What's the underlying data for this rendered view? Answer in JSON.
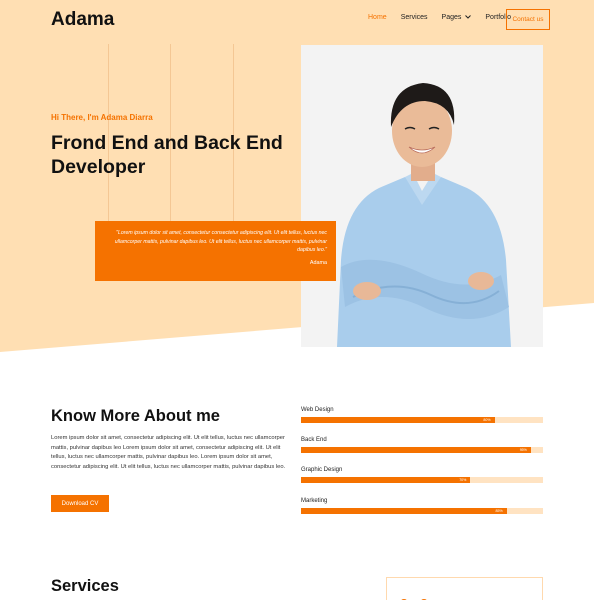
{
  "nav": {
    "logo": "Adama",
    "links": [
      {
        "label": "Home",
        "active": true
      },
      {
        "label": "Services",
        "active": false
      },
      {
        "label": "Pages",
        "active": false,
        "has_dropdown": true
      },
      {
        "label": "Portfolio",
        "active": false
      }
    ],
    "contact_label": "Contact us"
  },
  "hero": {
    "greeting": "Hi There, I'm Adama Diarra",
    "title_line1": "Frond End and Back End",
    "title_line2": "Developer",
    "quote": "\"Lorem ipsum dolor sit amet, consectetur consectetur adipiscing elit. Ut elit tellus, luctus nec ullamcorper mattis, pulvinar dapibus leo. Ut elit tellus, luctus nec ullamcorper mattis, pulvinar dapibus leo.\"",
    "quote_author": "Adama"
  },
  "about": {
    "title": "Know More About me",
    "text": "Lorem ipsum dolor sit amet, consectetur adipiscing elit. Ut elit tellus, luctus nec ullamcorper mattis, pulvinar dapibus leo Lorem ipsum dolor sit amet, consectetur adipiscing elit. Ut elit tellus, luctus nec ullamcorper mattis, pulvinar dapibus leo. Lorem ipsum dolor sit amet, consectetur adipiscing elit. Ut elit tellus, luctus nec ullamcorper mattis, pulvinar dapibus leo.",
    "button_label": "Download CV"
  },
  "skills": [
    {
      "label": "Web Design",
      "percent": 80,
      "percent_label": "80%"
    },
    {
      "label": "Back End",
      "percent": 95,
      "percent_label": "95%"
    },
    {
      "label": "Graphic Design",
      "percent": 70,
      "percent_label": "70%"
    },
    {
      "label": "Marketing",
      "percent": 85,
      "percent_label": "85%"
    }
  ],
  "services": {
    "title": "Services"
  },
  "colors": {
    "accent": "#f57200",
    "hero_bg": "#ffdfb3",
    "bar_track": "#ffe3c2"
  }
}
